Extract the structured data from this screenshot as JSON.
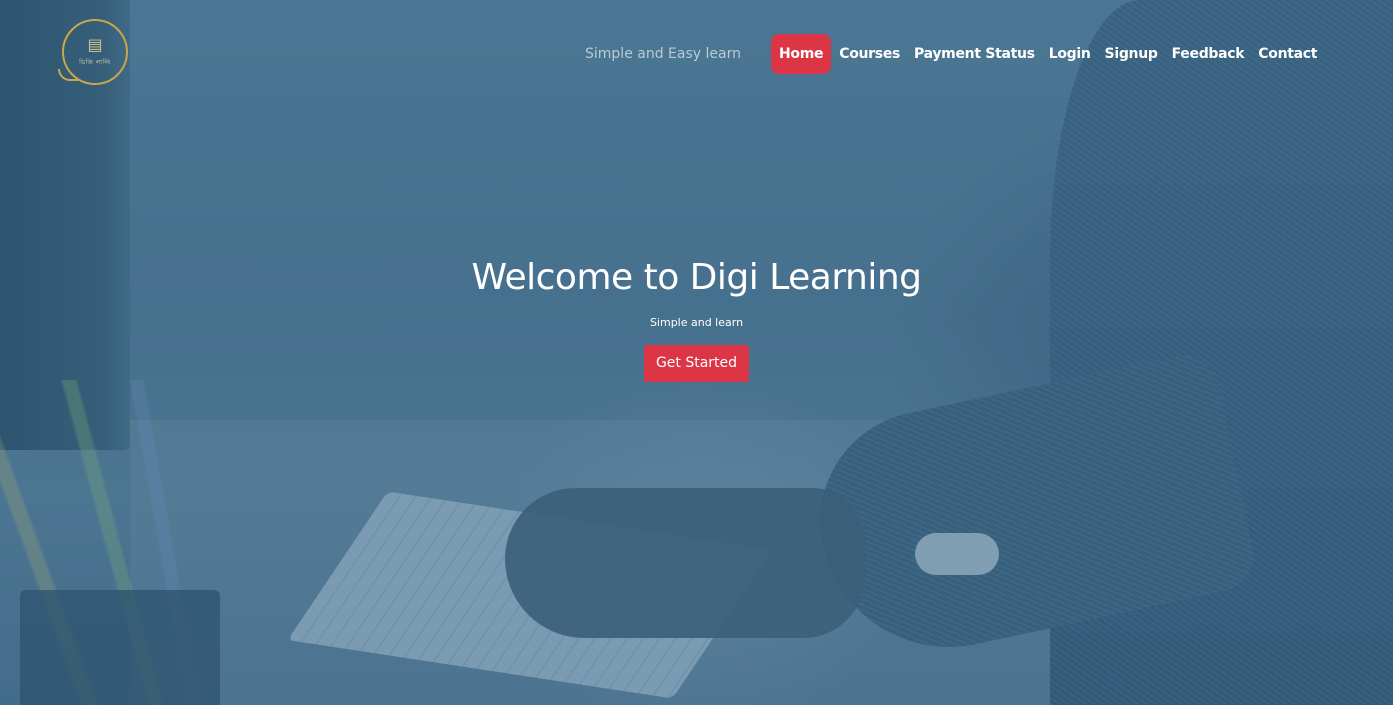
{
  "brand": {
    "logo_icon": "book-stack-icon",
    "logo_text": "ডিজি লার্নিং",
    "logo_color": "#c9a64a"
  },
  "header": {
    "tagline": "Simple and Easy learn"
  },
  "nav": {
    "items": [
      {
        "label": "Home",
        "active": true
      },
      {
        "label": "Courses"
      },
      {
        "label": "Payment Status"
      },
      {
        "label": "Login"
      },
      {
        "label": "Signup"
      },
      {
        "label": "Feedback"
      },
      {
        "label": "Contact"
      }
    ]
  },
  "hero": {
    "title": "Welcome to Digi Learning",
    "subtitle": "Simple and learn",
    "cta_label": "Get Started"
  },
  "colors": {
    "accent": "#dc3545",
    "overlay": "#4d7591",
    "text": "#ffffff"
  }
}
